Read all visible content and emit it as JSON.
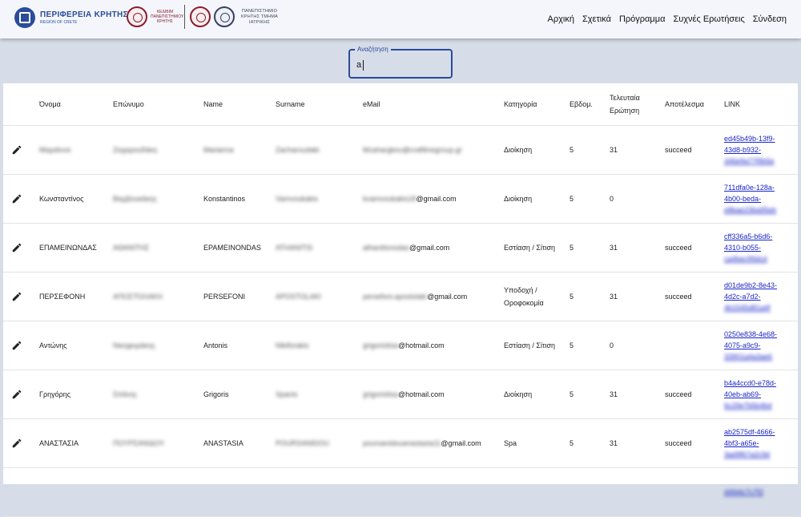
{
  "header": {
    "crete_title": "ΠΕΡΙΦΕΡΕΙΑ ΚΡΗΤΗΣ",
    "crete_subtitle": "REGION OF CRETE",
    "uni_text": "ΚΕΔΙΒΙΜ ΠΑΝΕΠΙΣΤΗΜΙΟΥ ΚΡΗΤΗΣ",
    "uni_text2": "ΠΑΝΕΠΙΣΤΗΜΙΟ ΚΡΗΤΗΣ ΤΜΗΜΑ ΙΑΤΡΙΚΗΣ",
    "nav": [
      "Αρχική",
      "Σχετικά",
      "Πρόγραμμα",
      "Συχνές Ερωτήσεις",
      "Σύνδεση"
    ]
  },
  "search": {
    "label": "Αναζήτηση",
    "value": "a"
  },
  "table": {
    "columns": [
      "Όνομα",
      "Επώνυμο",
      "Name",
      "Surname",
      "eMail",
      "Κατηγορία",
      "Εβδομ.",
      "Τελευταία Ερώτηση",
      "Αποτέλεσμα",
      "LINK"
    ],
    "rows": [
      {
        "onoma": "Μαριάννα",
        "eponymo": "Ζαχαρουδάκη",
        "name": "Marianna",
        "surname": "Zacharoudaki",
        "email_hidden": "Mzahargkou@craftlinegroup.gr",
        "email_visible": "",
        "category": "Διοίκηση",
        "week": "5",
        "last": "31",
        "result": "succeed",
        "link1": "ed45b49b-13f9-",
        "link2": "43d8-b932-",
        "link3": "346e9a77f9b5e"
      },
      {
        "onoma": "Κωνσταντίνος",
        "eponymo": "Βαμβουκάκης",
        "name": "Konstantinos",
        "surname": "Vamvoukakis",
        "email_hidden": "kvamvoukakis18",
        "email_visible": "@gmail.com",
        "category": "Διοίκηση",
        "week": "5",
        "last": "0",
        "result": "",
        "link1": "711dfa0e-128a-",
        "link2": "4b00-beda-",
        "link3": "e8bae23ba95eb"
      },
      {
        "onoma": "ΕΠΑΜΕΙΝΩΝΔΑΣ",
        "eponymo": "ΑΘΑΝΙΤΗΣ",
        "name": "EPAMEINONDAS",
        "surname": "ATHANITIS",
        "email_hidden": "athanitisnodas",
        "email_visible": "@gmail.com",
        "category": "Εστίαση / Σίτιση",
        "week": "5",
        "last": "31",
        "result": "succeed",
        "link1": "cff336a5-b6d6-",
        "link2": "4310-b055-",
        "link3": "ca4bec99dcd"
      },
      {
        "onoma": "ΠΕΡΣΕΦΟΝΗ",
        "eponymo": "ΑΠΟΣΤΟΛΑΚΗ",
        "name": "PERSEFONI",
        "surname": "APOSTOLAKI",
        "email_hidden": "persefoni.apostolaki",
        "email_visible": "@gmail.com",
        "category": "Υποδοχή / Οροφοκομία",
        "week": "5",
        "last": "31",
        "result": "succeed",
        "link1": "d01de9b2-8e43-",
        "link2": "4d2c-a7d2-",
        "link3": "4b1545d81a4f"
      },
      {
        "onoma": "Αντώνης",
        "eponymo": "Νικηφοράκης",
        "name": "Antonis",
        "surname": "Nikiforakis",
        "email_hidden": "grigoriotisa",
        "email_visible": "@hotmail.com",
        "category": "Εστίαση / Σίτιση",
        "week": "5",
        "last": "0",
        "result": "",
        "link1": "0250e838-4e68-",
        "link2": "4075-a9c9-",
        "link3": "33901a4a3ae6"
      },
      {
        "onoma": "Γρηγόρης",
        "eponymo": "Σπάνης",
        "name": "Grigoris",
        "surname": "Spanis",
        "email_hidden": "grigoriotisa",
        "email_visible": "@hotmail.com",
        "category": "Διοίκηση",
        "week": "5",
        "last": "31",
        "result": "succeed",
        "link1": "b4a4ccd0-e78d-",
        "link2": "40eb-ab69-",
        "link3": "6c29e7b5b4bd"
      },
      {
        "onoma": "ΑΝΑΣΤΑΣΙΑ",
        "eponymo": "ΠΟΥΡΣΑΝΙΔΟΥ",
        "name": "ANASTASIA",
        "surname": "POURSANIDOU",
        "email_hidden": "poursanidouanastasia11",
        "email_visible": "@gmail.com",
        "category": "Spa",
        "week": "5",
        "last": "31",
        "result": "succeed",
        "link1": "ab2575df-4666-",
        "link2": "4bf3-a65e-",
        "link3": "3ad9f67a2c9d"
      },
      {
        "onoma": "",
        "eponymo": "",
        "name": "",
        "surname": "",
        "email_hidden": "",
        "email_visible": "",
        "category": "",
        "week": "",
        "last": "",
        "result": "",
        "link1": "",
        "link2": "",
        "link3": "d4fd4c7c7f2"
      }
    ]
  }
}
